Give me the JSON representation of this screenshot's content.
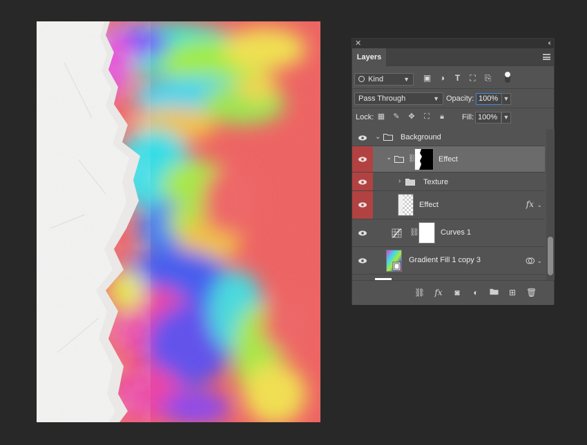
{
  "panel": {
    "close_glyph": "✕",
    "collapse_glyph": "‹‹",
    "tab_label": "Layers",
    "filter_kind": "Kind",
    "blend_mode": "Pass Through",
    "opacity_label": "Opacity:",
    "opacity_value": "100%",
    "lock_label": "Lock:",
    "fill_label": "Fill:",
    "fill_value": "100%"
  },
  "layers": [
    {
      "name": "Background",
      "type": "group",
      "expanded": true,
      "visible": true,
      "selected": false
    },
    {
      "name": "Effect",
      "type": "group-with-mask",
      "expanded": true,
      "visible": true,
      "selected": true
    },
    {
      "name": "Texture",
      "type": "group",
      "expanded": false,
      "visible": true,
      "selected": false
    },
    {
      "name": "Effect",
      "type": "pixel",
      "fx": "fx",
      "visible": true,
      "selected": false
    },
    {
      "name": "Curves 1",
      "type": "adjustment",
      "visible": true,
      "selected": false
    },
    {
      "name": "Gradient Fill 1 copy 3",
      "type": "smart-object",
      "visible": true,
      "selected": false
    }
  ],
  "icons": {
    "filter": "search-icon",
    "image_filter": "image-filter-icon",
    "adjustment_filter": "adjustment-filter-icon",
    "type_filter": "type-filter-icon",
    "shape_filter": "shape-filter-icon",
    "smart_filter": "smart-object-filter-icon",
    "filter_toggle": "filter-toggle-icon",
    "bottom": [
      "link-layers-icon",
      "fx-icon",
      "add-mask-icon",
      "adjustment-layer-icon",
      "new-group-icon",
      "new-layer-icon",
      "trash-icon"
    ]
  },
  "colors": {
    "selected_row": "#6b6b6b",
    "eye_highlight": "#b24242",
    "focus_border": "#4a84d9"
  }
}
